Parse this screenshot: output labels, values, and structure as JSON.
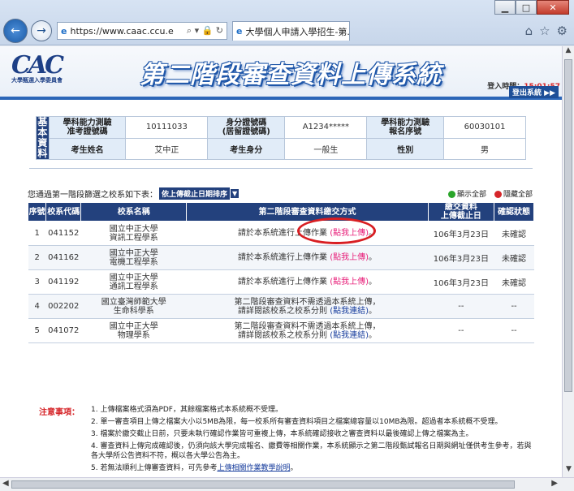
{
  "browser": {
    "url": "https://www.caac.ccu.e",
    "tab_title": "大學個人申請入學招生-第..."
  },
  "header": {
    "logo_text": "CAC",
    "logo_sub": "大學甄選入學委員會",
    "system_title": "第二階段審查資料上傳系統",
    "login_label": "登入時間：",
    "login_time": "15:01:57",
    "logout": "登出系統 ▶▶"
  },
  "info": {
    "side_label": "基本資料",
    "exam_id_label": "學科能力測驗\n准考證號碼",
    "exam_id": "10111033",
    "national_id_label": "身分證號碼\n(居留證號碼)",
    "national_id": "A1234*****",
    "app_no_label": "學科能力測驗\n報名序號",
    "app_no": "60030101",
    "name_label": "考生姓名",
    "name": "艾中正",
    "identity_label": "考生身分",
    "identity": "一般生",
    "gender_label": "性別",
    "gender": "男"
  },
  "list_intro": "您通過第一階段篩選之校系如下表：",
  "sort_option": "依上傳截止日期排序",
  "legend": {
    "expand_all": "顯示全部",
    "collapse_all": "隱藏全部"
  },
  "list": {
    "headers": [
      "序號",
      "校系代碼",
      "校系名稱",
      "第二階段審查資料繳交方式",
      "繳交資料\n上傳截止日",
      "確認狀態"
    ],
    "rows": [
      {
        "no": "1",
        "code": "041152",
        "name": "國立中正大學\n資訊工程學系",
        "method_pre": "請於本系統進行上傳作業 ",
        "method_link": "(點我上傳)",
        "method_post": "。",
        "deadline": "106年3月23日",
        "status": "未確認"
      },
      {
        "no": "2",
        "code": "041162",
        "name": "國立中正大學\n電機工程學系",
        "method_pre": "請於本系統進行上傳作業 ",
        "method_link": "(點我上傳)",
        "method_post": "。",
        "deadline": "106年3月23日",
        "status": "未確認"
      },
      {
        "no": "3",
        "code": "041192",
        "name": "國立中正大學\n通訊工程學系",
        "method_pre": "請於本系統進行上傳作業 ",
        "method_link": "(點我上傳)",
        "method_post": "。",
        "deadline": "106年3月23日",
        "status": "未確認"
      },
      {
        "no": "4",
        "code": "002202",
        "name": "國立臺灣師範大學\n生命科學系",
        "method_pre": "第二階段審查資料不需透過本系統上傳，\n請詳閱該校系之校系分則 ",
        "method_link": "(點我連結)",
        "method_post": "。",
        "deadline": "--",
        "status": "--"
      },
      {
        "no": "5",
        "code": "041072",
        "name": "國立中正大學\n物理學系",
        "method_pre": "第二階段審查資料不需透過本系統上傳，\n請詳閱該校系之校系分則 ",
        "method_link": "(點我連結)",
        "method_post": "。",
        "deadline": "--",
        "status": "--"
      }
    ]
  },
  "notes": {
    "heading": "注意事項：",
    "items": [
      "1. 上傳檔案格式須為PDF，其餘檔案格式本系統概不受理。",
      "2. 單一審查項目上傳之檔案大小以5MB為限，每一校系所有審查資料項目之檔案總容量以10MB為限。超過者本系統概不受理。",
      "3. 檔案於繳交截止日前，只要未執行確認作業皆可重複上傳，本系統確認接收之審查資料以最後確認上傳之檔案為主。",
      "4. 審查資料上傳完成確認後，仍須向該大學完成報名、繳費等相關作業，本系統顯示之第二階段甄試報名日期與網址僅供考生參考，若與各大學所公告資料不符，概以各大學公告為主。"
    ],
    "last_pre": "5. 若無法順利上傳審查資料，可先參考",
    "last_link": "上傳相關作業教學說明",
    "last_post": "。"
  }
}
